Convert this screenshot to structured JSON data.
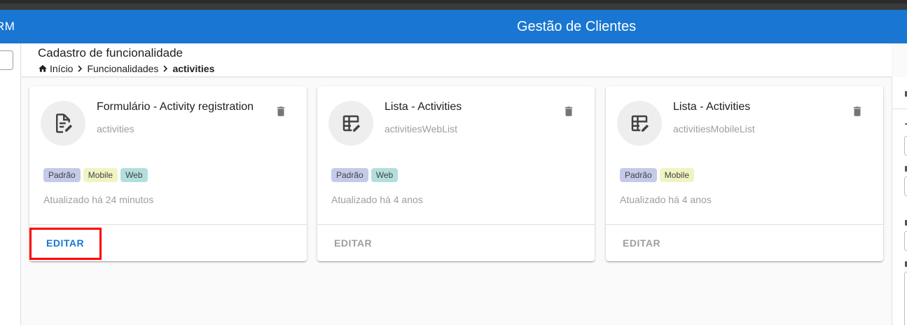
{
  "appbar": {
    "brand": "RM",
    "title": "Gestão de Clientes",
    "color": "#1976d2"
  },
  "page": {
    "title": "Cadastro de funcionalidade"
  },
  "breadcrumb": {
    "items": [
      "Início",
      "Funcionalidades",
      "activities"
    ]
  },
  "cards": [
    {
      "title": "Formulário - Activity registration",
      "subtitle": "activities",
      "icon": "form-document-edit-icon",
      "tags": [
        "Padrão",
        "Mobile",
        "Web"
      ],
      "updated": "Atualizado há 24 minutos",
      "edit_label": "EDITAR"
    },
    {
      "title": "Lista - Activities",
      "subtitle": "activitiesWebList",
      "icon": "table-edit-icon",
      "tags": [
        "Padrão",
        "Web"
      ],
      "updated": "Atualizado há 4 anos",
      "edit_label": "EDITAR"
    },
    {
      "title": "Lista - Activities",
      "subtitle": "activitiesMobileList",
      "icon": "table-edit-icon",
      "tags": [
        "Padrão",
        "Mobile"
      ],
      "updated": "Atualizado há 4 anos",
      "edit_label": "EDITAR"
    }
  ],
  "tag_colors": {
    "Padrão": "#c5cae9",
    "Mobile": "#f0f4c3",
    "Web": "#b2dfdb"
  },
  "highlight_color": "#ff0000"
}
